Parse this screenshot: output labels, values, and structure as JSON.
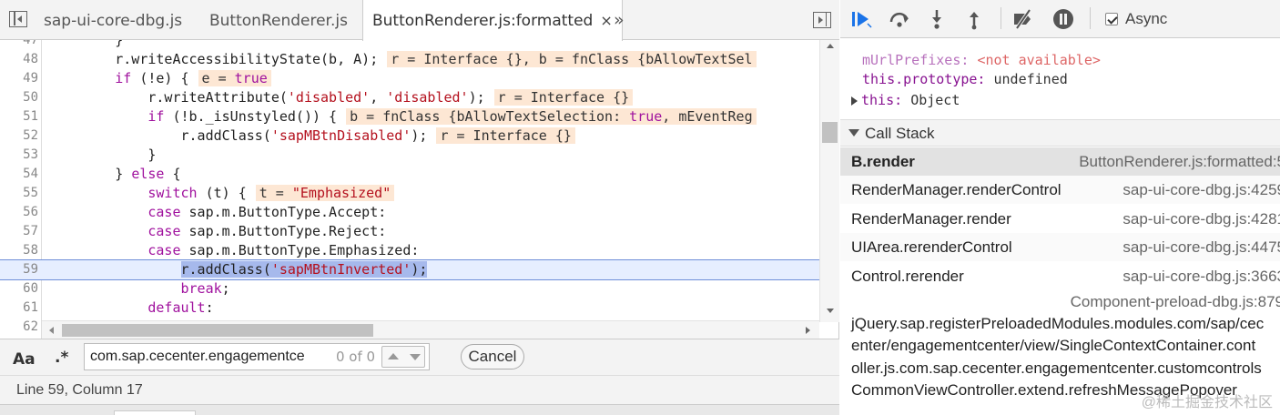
{
  "tabs": [
    {
      "label": "sap-ui-core-dbg.js",
      "active": false
    },
    {
      "label": "ButtonRenderer.js",
      "active": false
    },
    {
      "label": "ButtonRenderer.js:formatted",
      "active": true
    }
  ],
  "tab_close": "×",
  "more_tabs": "»",
  "code_lines": [
    {
      "num": "47",
      "text": "        }"
    },
    {
      "num": "48",
      "text": "        r.writeAccessibilityState(b, A);"
    },
    {
      "num": "49",
      "text": "        if (!e) {"
    },
    {
      "num": "50",
      "text": "            r.writeAttribute('disabled', 'disabled');"
    },
    {
      "num": "51",
      "text": "            if (!b._isUnstyled()) {"
    },
    {
      "num": "52",
      "text": "                r.addClass('sapMBtnDisabled');"
    },
    {
      "num": "53",
      "text": "            }"
    },
    {
      "num": "54",
      "text": "        } else {"
    },
    {
      "num": "55",
      "text": "            switch (t) {"
    },
    {
      "num": "56",
      "text": "            case sap.m.ButtonType.Accept:"
    },
    {
      "num": "57",
      "text": "            case sap.m.ButtonType.Reject:"
    },
    {
      "num": "58",
      "text": "            case sap.m.ButtonType.Emphasized:"
    },
    {
      "num": "59",
      "text": "                r.addClass('sapMBtnInverted');"
    },
    {
      "num": "60",
      "text": "                break;"
    },
    {
      "num": "61",
      "text": "            default:"
    },
    {
      "num": "62",
      "text": ""
    }
  ],
  "annotations": {
    "48": "r = Interface {}, b = fnClass {bAllowTextSel",
    "49": "e = true",
    "50": "r = Interface {}",
    "51": "b = fnClass {bAllowTextSelection: true, mEventReg",
    "52": "r = Interface {}",
    "55": "t = \"Emphasized\""
  },
  "search": {
    "case_label": "Aa",
    "regex_label": ".*",
    "value": "com.sap.cecenter.engagementce",
    "match_count": "0 of 0",
    "cancel_label": "Cancel"
  },
  "status": {
    "position": "Line 59, Column 17"
  },
  "debugger": {
    "async_label": "Async",
    "async_checked": true
  },
  "scope": {
    "url_prefixes_name": "mUrlPrefixes:",
    "url_prefixes_value": "<not available>",
    "prototype_name": "this.prototype:",
    "prototype_value": "undefined",
    "this_name": "this:",
    "this_value": "Object"
  },
  "call_stack": {
    "title": "Call Stack",
    "frames": [
      {
        "fn": "B.render",
        "loc": "ButtonRenderer.js:formatted:5",
        "selected": true
      },
      {
        "fn": "RenderManager.renderControl",
        "loc": "sap-ui-core-dbg.js:4259"
      },
      {
        "fn": "RenderManager.render",
        "loc": "sap-ui-core-dbg.js:4281"
      },
      {
        "fn": "UIArea.rerenderControl",
        "loc": "sap-ui-core-dbg.js:4475"
      },
      {
        "fn": "Control.rerender",
        "loc": "sap-ui-core-dbg.js:3663"
      }
    ],
    "long_frame": {
      "loc": "Component-preload-dbg.js:879",
      "lines": [
        "jQuery.sap.registerPreloadedModules.modules.com/sap/cec",
        "enter/engagementcenter/view/SingleContextContainer.cont",
        "oller.js.com.sap.cecenter.engagementcenter.customcontrols",
        "CommonViewController.extend.refreshMessagePopover"
      ]
    }
  },
  "watermark": "@稀土掘金技术社区",
  "colors": {
    "accent": "#1a73e8",
    "annotation_bg": "#fde7d4",
    "exec_line_bg": "#e6eeff",
    "keyword": "#a0129e",
    "string": "#b4111e"
  }
}
